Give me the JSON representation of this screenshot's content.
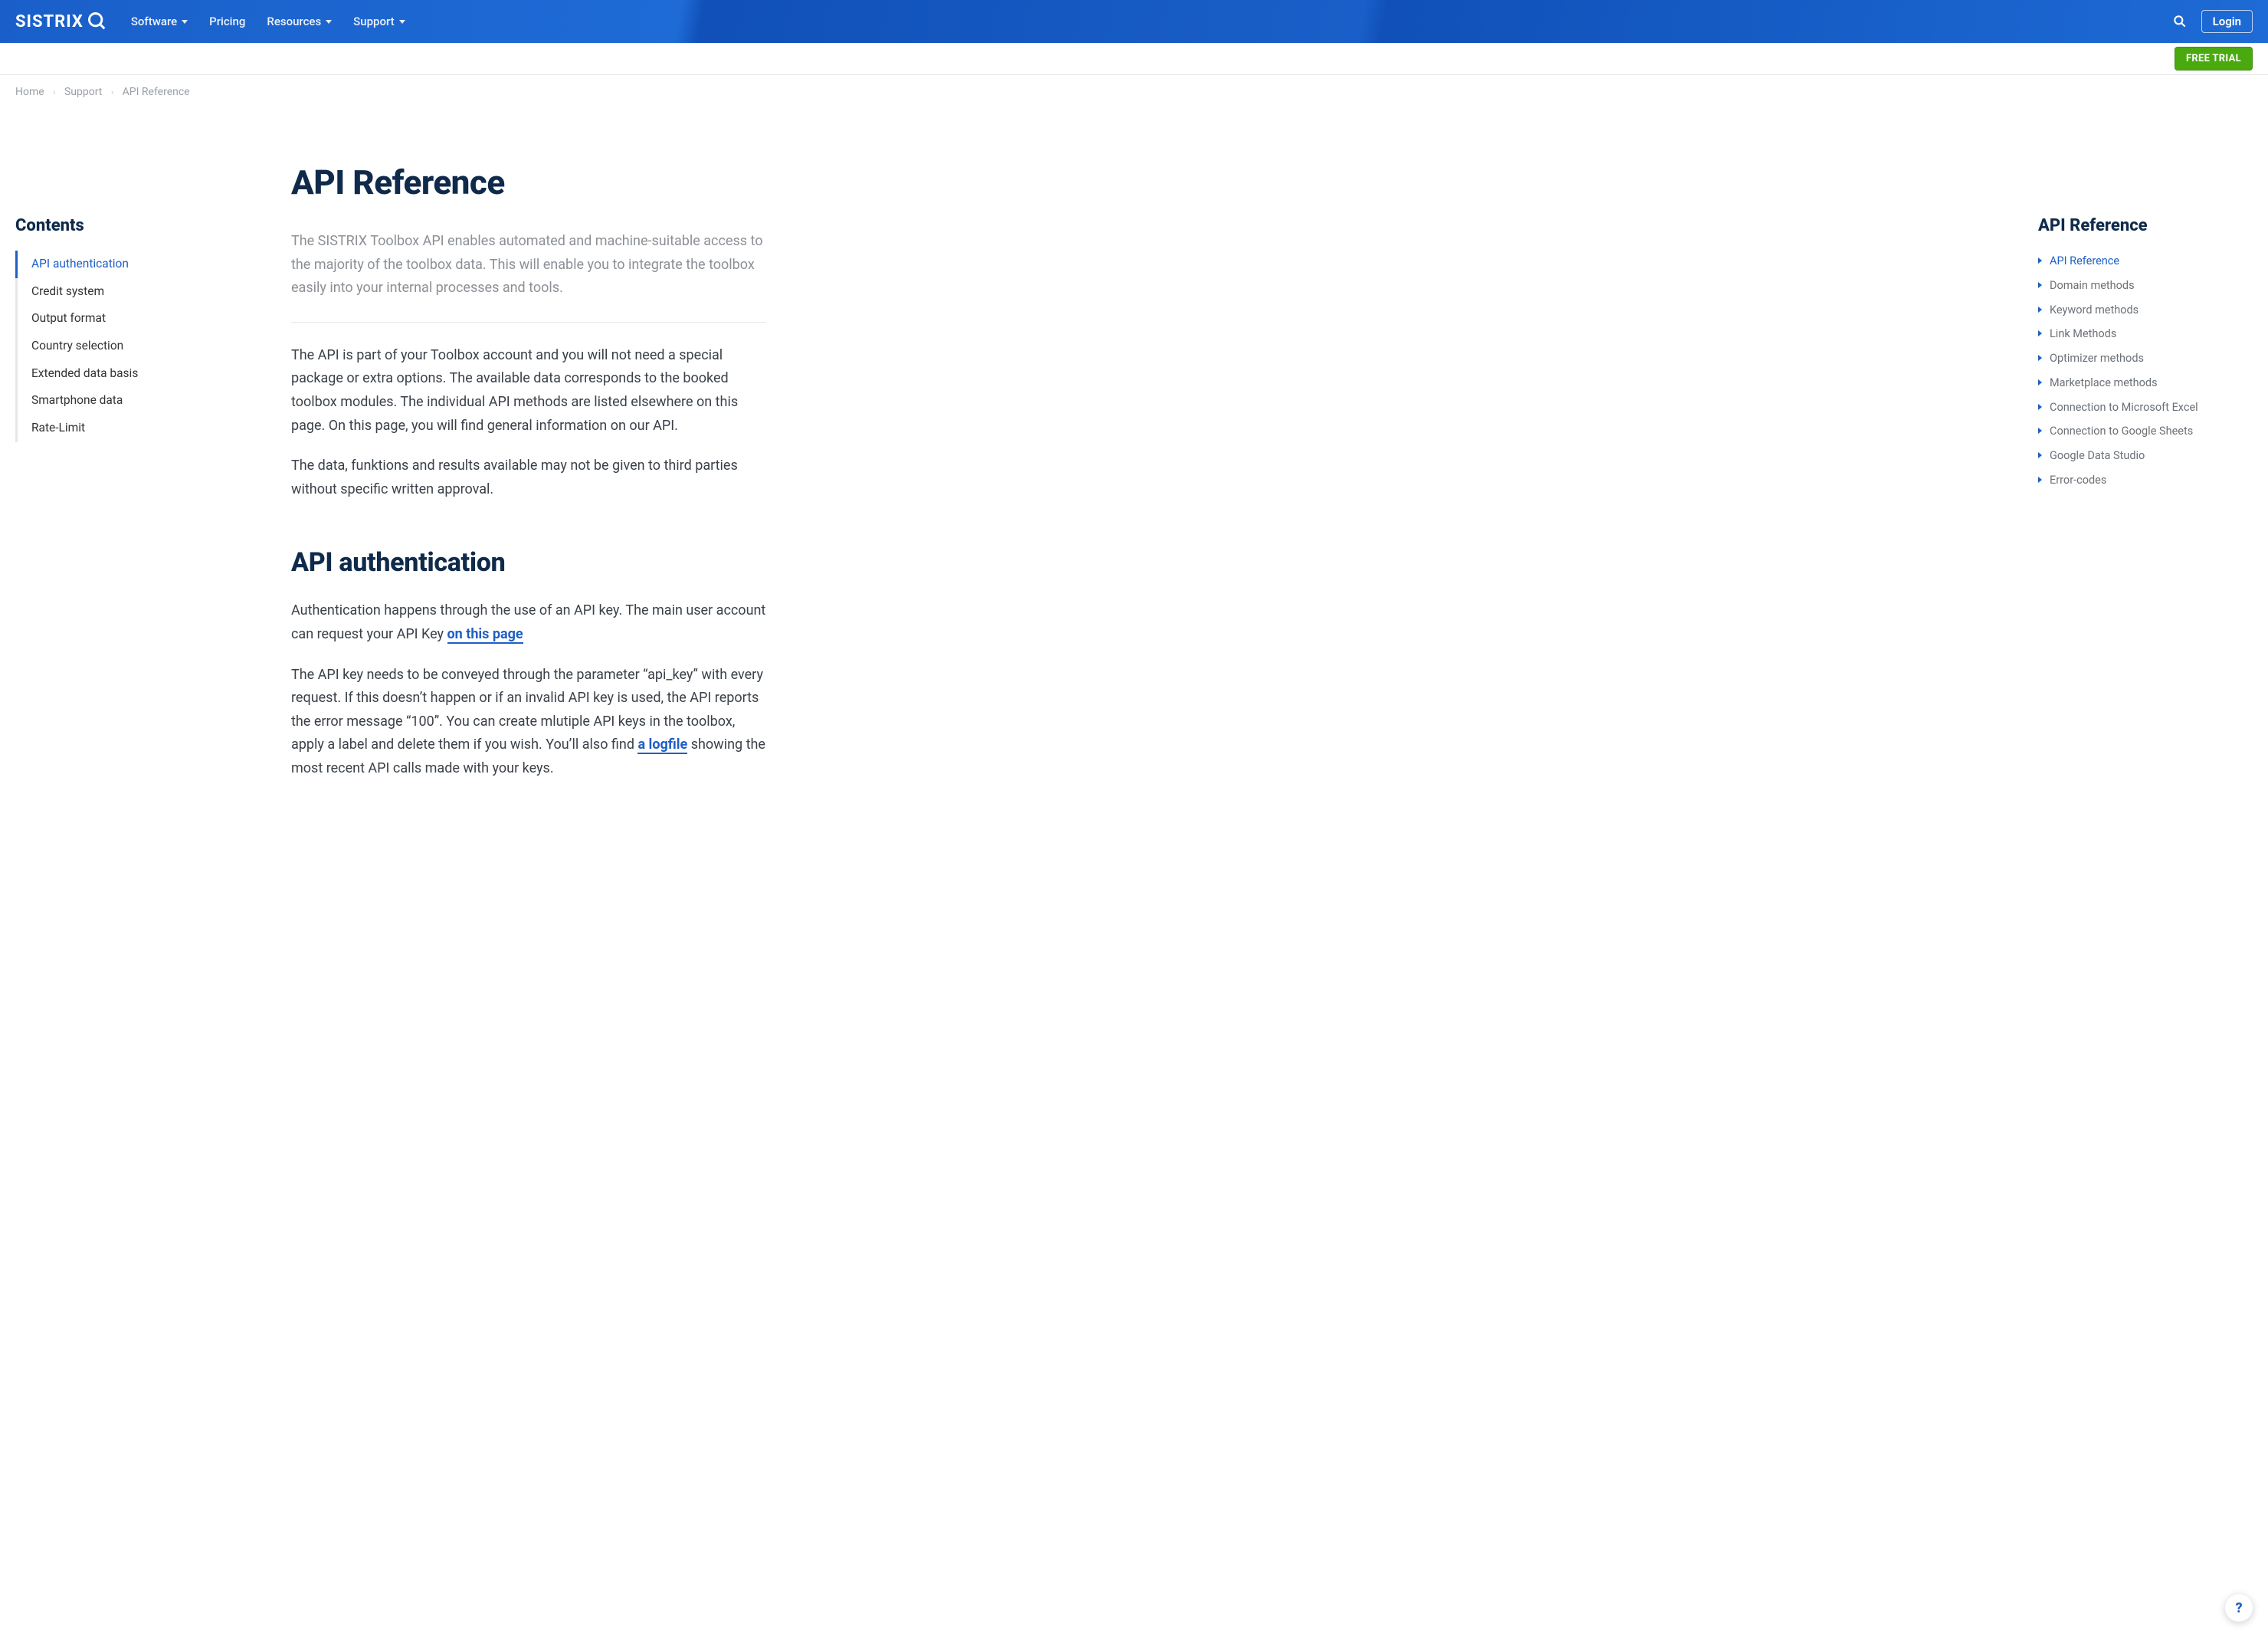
{
  "brand": "SISTRIX",
  "nav": {
    "items": [
      {
        "label": "Software",
        "dropdown": true
      },
      {
        "label": "Pricing",
        "dropdown": false
      },
      {
        "label": "Resources",
        "dropdown": true
      },
      {
        "label": "Support",
        "dropdown": true
      }
    ],
    "login": "Login"
  },
  "subbar": {
    "free_trial": "FREE TRIAL"
  },
  "breadcrumb": [
    "Home",
    "Support",
    "API Reference"
  ],
  "contents": {
    "title": "Contents",
    "items": [
      {
        "label": "API authentication",
        "active": true
      },
      {
        "label": "Credit system"
      },
      {
        "label": "Output format"
      },
      {
        "label": "Country selection"
      },
      {
        "label": "Extended data basis"
      },
      {
        "label": "Smartphone data"
      },
      {
        "label": "Rate-Limit"
      }
    ]
  },
  "article": {
    "title": "API Reference",
    "intro": "The SISTRIX Toolbox API enables automated and machine-suitable access to the majority of the toolbox data. This will enable you to integrate the toolbox easily into your internal processes and tools.",
    "p1": "The API is part of your Toolbox account and you will not need a special package or extra options. The available data corresponds to the booked toolbox modules. The individual API methods are listed elsewhere on this page. On this page, you will find general information on our API.",
    "p2": "The data, funktions and results available may not be given to third parties without specific written approval.",
    "h2": "API authentication",
    "auth_p1_pre": "Authentication happens through the use of an API key. The main user account can request your API Key ",
    "auth_p1_link": "on this page",
    "auth_p2_pre": "The API key needs to be conveyed through the parameter “api_key” with every request. If this doesn’t happen or if an invalid API key is used, the API reports the error message “100”. You can create mlutiple API keys in the toolbox, apply a label and delete them if you wish. You’ll also find ",
    "auth_p2_link": "a logfile",
    "auth_p2_post": " showing the most recent API calls made with your keys."
  },
  "right": {
    "title": "API Reference",
    "items": [
      {
        "label": "API Reference",
        "active": true
      },
      {
        "label": "Domain methods"
      },
      {
        "label": "Keyword methods"
      },
      {
        "label": "Link Methods"
      },
      {
        "label": "Optimizer methods"
      },
      {
        "label": "Marketplace methods"
      },
      {
        "label": "Connection to Microsoft Excel"
      },
      {
        "label": "Connection to Google Sheets"
      },
      {
        "label": "Google Data Studio"
      },
      {
        "label": "Error-codes"
      }
    ]
  },
  "help": "?"
}
